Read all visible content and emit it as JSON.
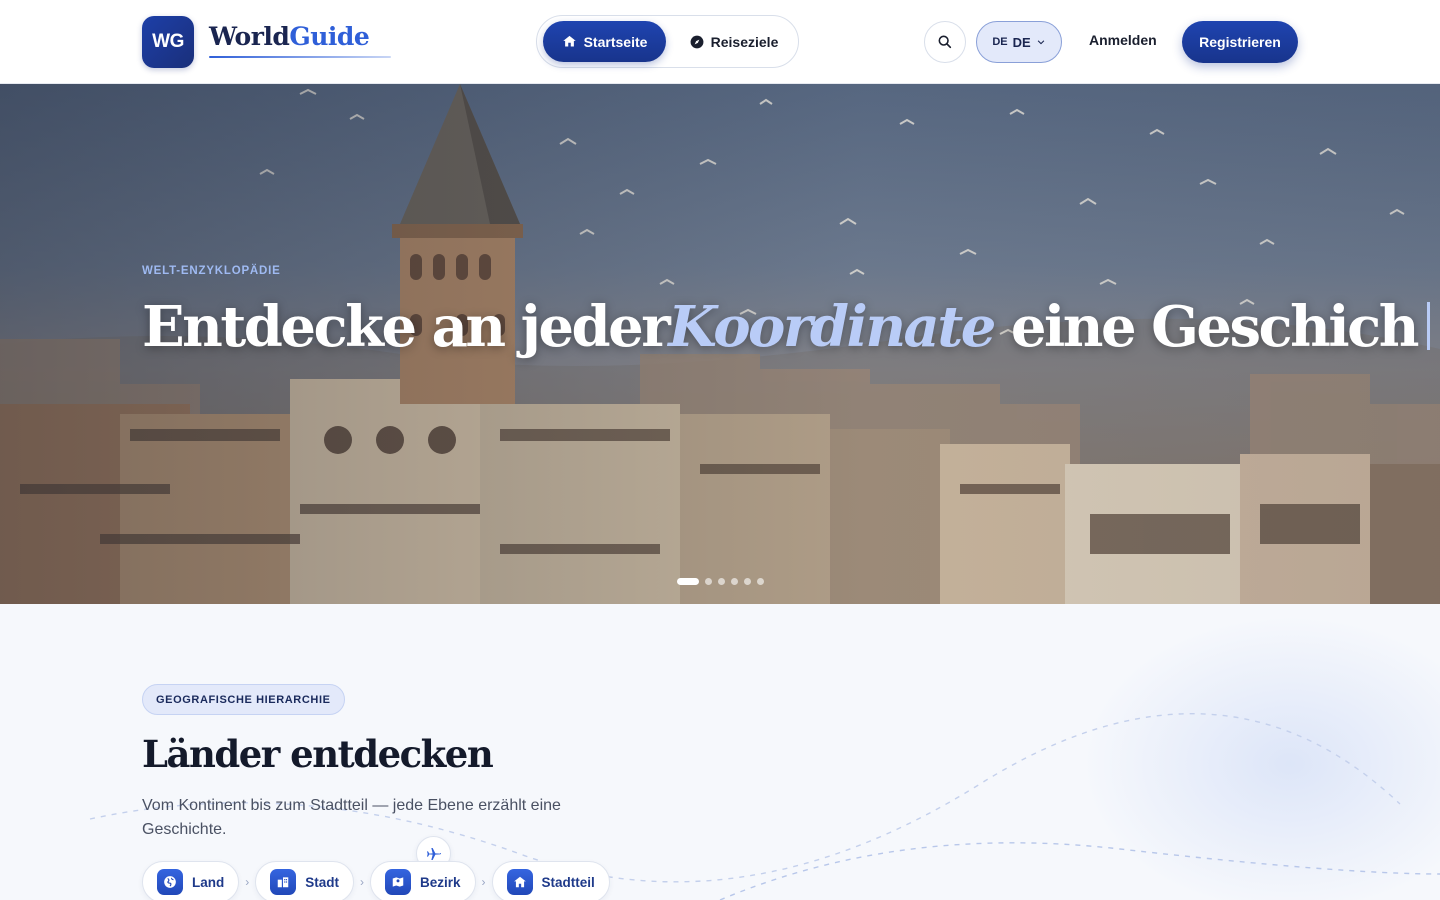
{
  "header": {
    "logo_mark": "WG",
    "logo_word_1": "World",
    "logo_word_2": "Guide",
    "nav": [
      {
        "label": "Startseite",
        "icon": "home-icon",
        "active": true
      },
      {
        "label": "Reiseziele",
        "icon": "compass-icon",
        "active": false
      }
    ],
    "search_icon": "search-icon",
    "language": {
      "flag": "DE",
      "code": "DE"
    },
    "login_label": "Anmelden",
    "register_label": "Registrieren"
  },
  "hero": {
    "eyebrow": "WELT-ENZYKLOPÄDIE",
    "title_part_1": "Entdecke an jeder",
    "title_accent": "Koordinate",
    "title_part_2": " eine Geschich",
    "slides_count": 6,
    "active_slide": 1
  },
  "section": {
    "badge": "GEOGRAFISCHE HIERARCHIE",
    "title": "Länder entdecken",
    "description": "Vom Kontinent bis zum Stadtteil — jede Ebene erzählt eine Geschichte.",
    "levels": [
      {
        "label": "Land",
        "icon": "globe-icon"
      },
      {
        "label": "Stadt",
        "icon": "city-icon"
      },
      {
        "label": "Bezirk",
        "icon": "map-icon"
      },
      {
        "label": "Stadtteil",
        "icon": "house-icon"
      }
    ],
    "plane_icon": "plane-icon"
  },
  "colors": {
    "primary": "#1f44b0",
    "accent": "#2f5fd8",
    "hero_accent": "#b9ccf7",
    "eyebrow": "#9fbaf2"
  }
}
